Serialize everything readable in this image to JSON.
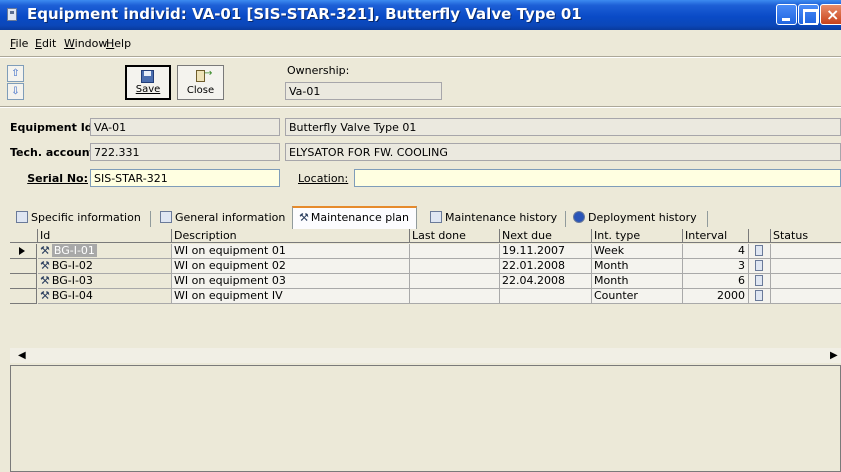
{
  "window": {
    "title": "Equipment individ: VA-01 [SIS-STAR-321], Butterfly Valve Type 01"
  },
  "menu": [
    "File",
    "Edit",
    "Window",
    "Help"
  ],
  "toolbar": {
    "save_label": "Save",
    "close_label": "Close",
    "ownership_label": "Ownership:",
    "ownership_value": "Va-01"
  },
  "form": {
    "equipment_id_label": "Equipment Id:",
    "equipment_id_value": "VA-01",
    "equipment_desc": "Butterfly Valve Type 01",
    "tech_account_label": "Tech. account:",
    "tech_account_value": "722.331",
    "tech_account_desc": "ELYSATOR FOR FW. COOLING",
    "serial_label": "Serial No:",
    "serial_value": "SIS-STAR-321",
    "location_label": "Location:",
    "location_value": ""
  },
  "tabs": [
    {
      "label": "Specific information"
    },
    {
      "label": "General information"
    },
    {
      "label": "Maintenance plan",
      "active": true
    },
    {
      "label": "Maintenance history"
    },
    {
      "label": "Deployment history"
    }
  ],
  "grid": {
    "columns": [
      "Id",
      "Description",
      "Last done",
      "Next due",
      "Int. type",
      "Interval",
      "",
      "Status"
    ],
    "rows": [
      {
        "id": "BG-I-01",
        "description": "WI on equipment 01",
        "last_done": "",
        "next_due": "19.11.2007",
        "int_type": "Week",
        "interval": "4",
        "status": "",
        "selected": true
      },
      {
        "id": "BG-I-02",
        "description": "WI on equipment 02",
        "last_done": "",
        "next_due": "22.01.2008",
        "int_type": "Month",
        "interval": "3",
        "status": ""
      },
      {
        "id": "BG-I-03",
        "description": "WI on equipment 03",
        "last_done": "",
        "next_due": "22.04.2008",
        "int_type": "Month",
        "interval": "6",
        "status": ""
      },
      {
        "id": "BG-I-04",
        "description": "WI on equipment IV",
        "last_done": "",
        "next_due": "",
        "int_type": "Counter",
        "interval": "2000",
        "status": ""
      }
    ]
  },
  "icons": {
    "wrench": "wrench-icon",
    "note": "note-icon"
  }
}
